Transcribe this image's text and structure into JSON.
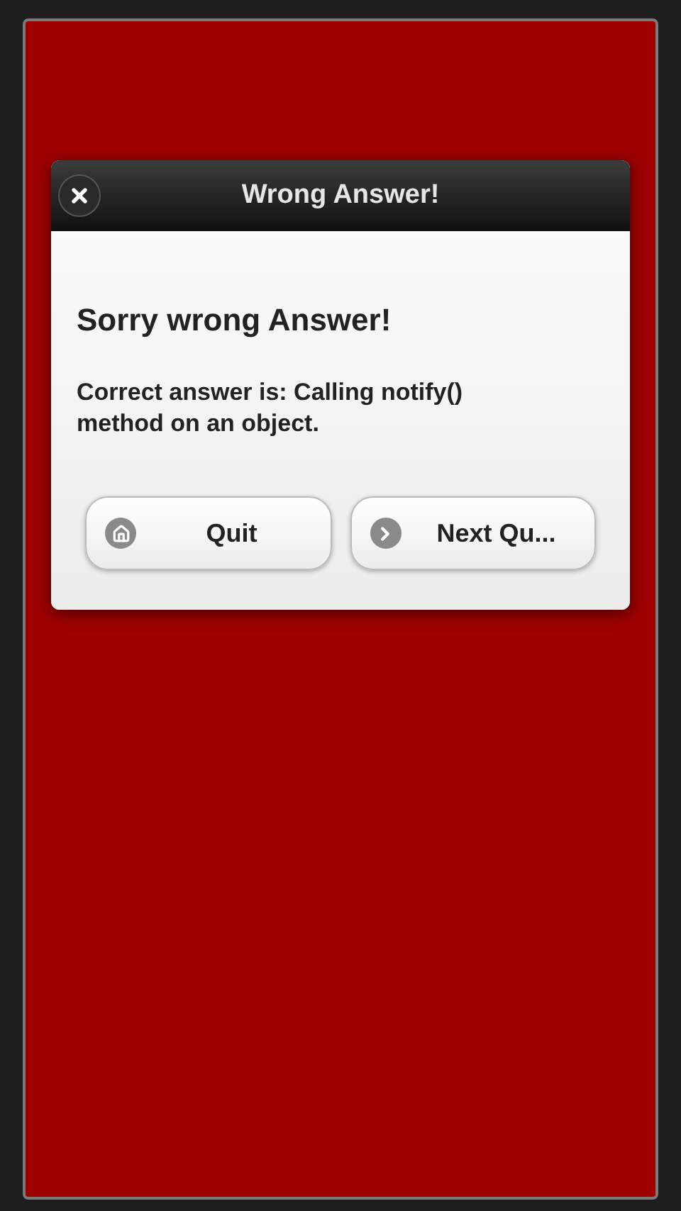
{
  "dialog": {
    "title": "Wrong Answer!",
    "heading": "Sorry wrong Answer!",
    "message": "Correct answer is: Calling notify() method on an object.",
    "buttons": [
      {
        "label": "Quit",
        "kind": "home"
      },
      {
        "label": "Next Qu...",
        "kind": "next"
      }
    ]
  }
}
